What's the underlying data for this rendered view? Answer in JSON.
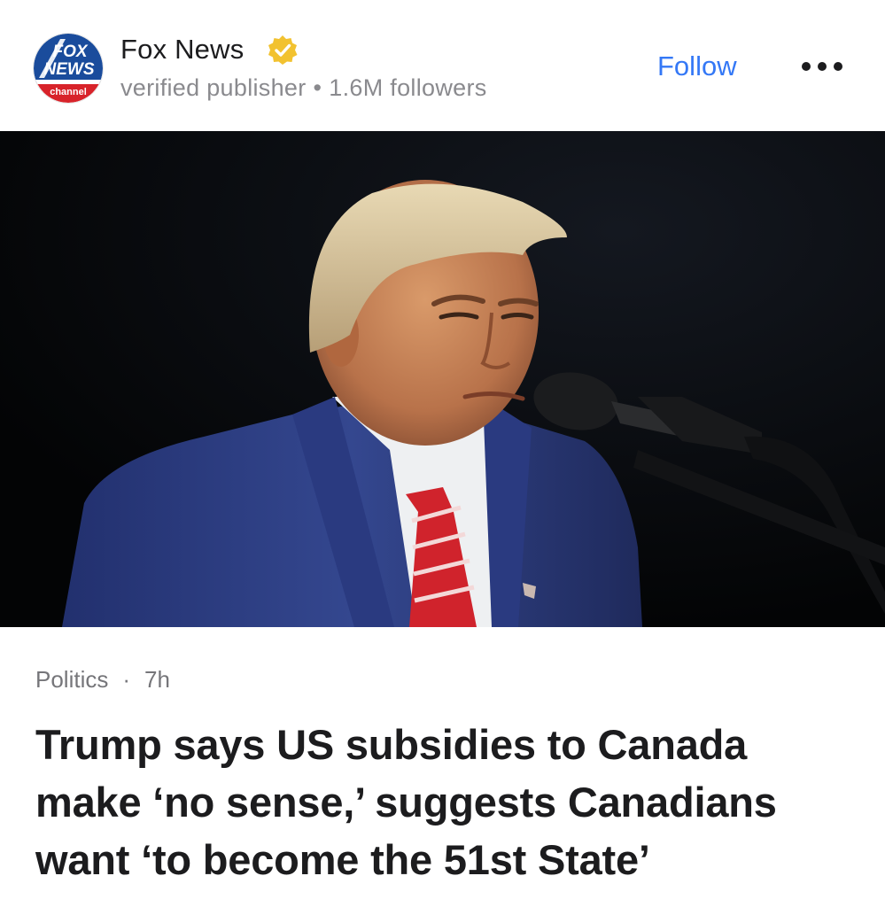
{
  "publisher": {
    "name": "Fox News",
    "descriptor": "verified publisher",
    "separator": "•",
    "followers": "1.6M followers",
    "logo_text_top": "FOX",
    "logo_text_mid": "NEWS",
    "logo_text_bottom": "channel"
  },
  "actions": {
    "follow_label": "Follow",
    "more_icon": "more-horizontal-icon"
  },
  "article": {
    "category": "Politics",
    "separator": "·",
    "age": "7h",
    "headline": "Trump says US subsidies to Canada make ‘no sense,’ suggests Canadians want ‘to become the 51st State’"
  },
  "colors": {
    "follow": "#3478f6",
    "verified_badge": "#f2c230",
    "headline": "#1c1c1e",
    "meta": "#76767a",
    "logo_blue": "#1a4c9c",
    "logo_red": "#d8232a"
  }
}
